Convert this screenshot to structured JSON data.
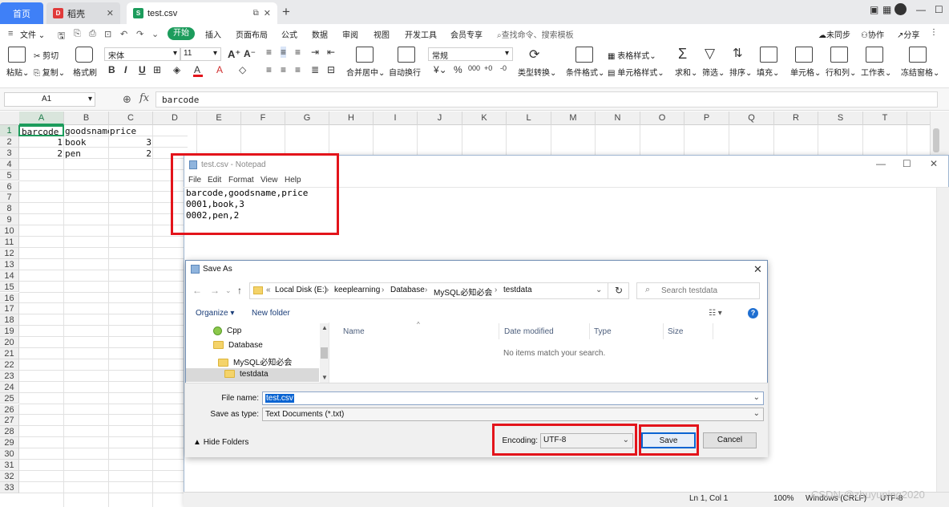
{
  "tabs": {
    "home": "首页",
    "docer": "稻壳",
    "file": "test.csv"
  },
  "menus": [
    "文件",
    "开始",
    "插入",
    "页面布局",
    "公式",
    "数据",
    "审阅",
    "视图",
    "开发工具",
    "会员专享"
  ],
  "search_cmd": "查找命令、搜索模板",
  "account": {
    "sync": "未同步",
    "collab": "协作",
    "share": "分享"
  },
  "ribbon": {
    "paste": "粘贴",
    "cut": "剪切",
    "copy": "复制",
    "format_painter": "格式刷",
    "font_name": "宋体",
    "font_size": "11",
    "merge": "合并居中",
    "wrap": "自动换行",
    "number_format": "常规",
    "type_convert": "类型转换",
    "cond_format": "条件格式",
    "table_style": "表格样式",
    "cell_style": "单元格样式",
    "sum": "求和",
    "filter": "筛选",
    "sort": "排序",
    "fill": "填充",
    "cell": "单元格",
    "row_col": "行和列",
    "worksheet": "工作表",
    "freeze": "冻结窗格"
  },
  "namebox": "A1",
  "formula": "barcode",
  "columns": [
    "A",
    "B",
    "C",
    "D",
    "E",
    "F",
    "G",
    "H",
    "I",
    "J",
    "K",
    "L",
    "M",
    "N",
    "O",
    "P",
    "Q",
    "R",
    "S",
    "T"
  ],
  "rows": [
    "1",
    "2",
    "3",
    "4",
    "5",
    "6",
    "7",
    "8",
    "9",
    "10",
    "11",
    "12",
    "13",
    "14",
    "15",
    "16",
    "17",
    "18",
    "19",
    "20",
    "21",
    "22",
    "23",
    "24",
    "25",
    "26",
    "27",
    "28",
    "29",
    "30",
    "31",
    "32",
    "33"
  ],
  "cells": {
    "A1": "barcode",
    "B1": "goodsname",
    "C1": "price",
    "A2": "1",
    "B2": "book",
    "C2": "3",
    "A3": "2",
    "B3": "pen",
    "C3": "2"
  },
  "notepad": {
    "title": "test.csv - Notepad",
    "menu": [
      "File",
      "Edit",
      "Format",
      "View",
      "Help"
    ],
    "lines": [
      "barcode,goodsname,price",
      "0001,book,3",
      "0002,pen,2"
    ],
    "status": {
      "pos": "Ln 1, Col 1",
      "zoom": "100%",
      "eol": "Windows (CRLF)",
      "enc": "UTF-8"
    }
  },
  "saveas": {
    "title": "Save As",
    "breadcrumb": [
      "Local Disk (E:)",
      "keeplearning",
      "Database",
      "MySQL必知必会",
      "testdata"
    ],
    "search_placeholder": "Search testdata",
    "organize": "Organize",
    "new_folder": "New folder",
    "tree": [
      "Cpp",
      "Database",
      "MySQL必知必会",
      "testdata"
    ],
    "columns": [
      "Name",
      "Date modified",
      "Type",
      "Size"
    ],
    "empty": "No items match your search.",
    "file_name_label": "File name:",
    "file_name": "test.csv",
    "save_type_label": "Save as type:",
    "save_type": "Text Documents (*.txt)",
    "hide_folders": "Hide Folders",
    "encoding_label": "Encoding:",
    "encoding": "UTF-8",
    "save": "Save",
    "cancel": "Cancel"
  },
  "watermark": "CSDN @zhuyuping2020"
}
